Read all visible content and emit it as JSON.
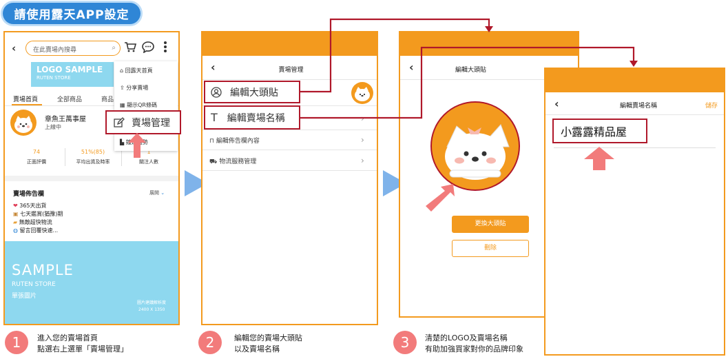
{
  "title": "請使用露天APP設定",
  "panel1": {
    "search_placeholder": "在此賣場內搜尋",
    "logo_title": "LOGO SAMPLE",
    "logo_sub": "RUTEN STORE",
    "tabs": [
      "賣場首頁",
      "全部商品",
      "商品"
    ],
    "store_name": "章魚王萬事屋",
    "status": "上線中",
    "stats": [
      {
        "value": "74",
        "label": "正面評價"
      },
      {
        "value": "51%(85)",
        "label": "平均出貨及時率"
      },
      {
        "value": "1",
        "label": "關注人數"
      }
    ],
    "menu": [
      "回露天首頁",
      "分享賣場",
      "顯示QR條碼",
      "賣場管理",
      "鐘進趨勢"
    ],
    "board_title": "賣場佈告欄",
    "expand": "展開",
    "board_items": [
      "365天出貨",
      "七天鑑賞(猶豫)期",
      "無敵超快物流",
      "留言回覆快速..."
    ],
    "banner_title": "SAMPLE",
    "banner_sub": "RUTEN STORE",
    "banner_note": "單張圖片",
    "banner_res_label": "圖片建議解析度",
    "banner_res": "2400 X 1350"
  },
  "panel2": {
    "header": "賣場管理",
    "items": [
      "編輯大頭貼",
      "編輯賣場名稱",
      "編輯佈告欄內容",
      "物流服務管理"
    ]
  },
  "panel3": {
    "header": "編輯大頭貼",
    "change_btn": "更換大頭貼",
    "delete_btn": "刪除"
  },
  "panel4": {
    "header": "編輯賣場名稱",
    "save": "儲存",
    "store_name": "小露露精品屋"
  },
  "steps": [
    {
      "num": "1",
      "line1": "進入您的賣場首頁",
      "line2": "點選右上選單「賣場管理」"
    },
    {
      "num": "2",
      "line1": "編輯您的賣場大頭貼",
      "line2": "以及賣場名稱"
    },
    {
      "num": "3",
      "line1": "清楚的LOGO及賣場名稱",
      "line2": "有助加強買家對你的品牌印象"
    }
  ],
  "colors": {
    "orange": "#f39a1e",
    "red": "#b0182a",
    "blue": "#2f86d6",
    "cyan": "#8ed8ef",
    "arrow": "#7fb3ea",
    "pink": "#f27b7b"
  }
}
